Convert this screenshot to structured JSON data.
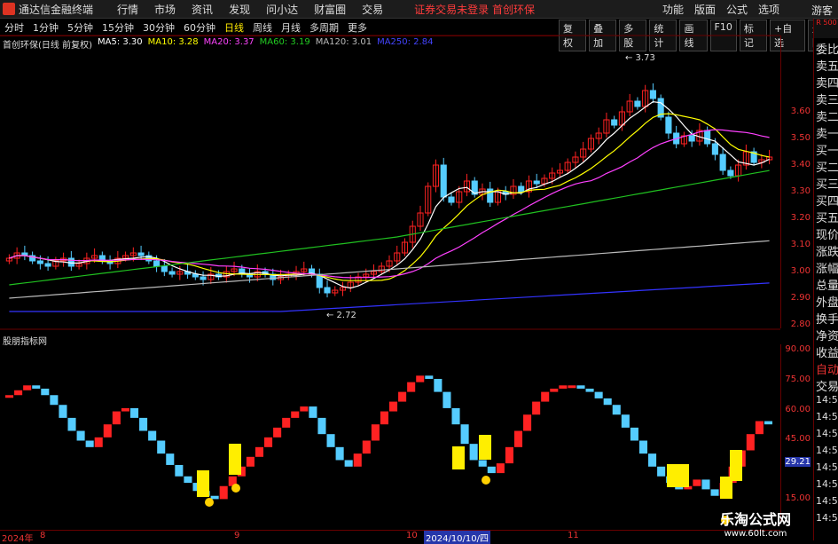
{
  "app": {
    "name": "通达信金融终端",
    "notice": "证券交易未登录 首创环保",
    "menu": [
      "行情",
      "市场",
      "资讯",
      "发现",
      "问小达",
      "财富圈",
      "交易"
    ],
    "right_menu": [
      "功能",
      "版面",
      "公式",
      "选项"
    ],
    "guest": "游客"
  },
  "tabs": [
    "分时",
    "1分钟",
    "5分钟",
    "15分钟",
    "30分钟",
    "60分钟",
    "日线",
    "周线",
    "月线",
    "多周期",
    "更多"
  ],
  "active_tab": "日线",
  "tools": [
    "复权",
    "叠加",
    "多股",
    "统计",
    "画线",
    "F10",
    "标记",
    "+自选",
    "返回"
  ],
  "legend": {
    "title": "首创环保(日线 前复权)",
    "ma5": "MA5: 3.30",
    "ma10": "MA10: 3.28",
    "ma20": "MA20: 3.37",
    "ma60": "MA60: 3.19",
    "ma120": "MA120: 3.01",
    "ma250": "MA250: 2.84"
  },
  "colors": {
    "ma5": "#ffffff",
    "ma10": "#ffff00",
    "ma20": "#ff40ff",
    "ma60": "#20c020",
    "ma120": "#bbbbbb",
    "ma250": "#3333ff",
    "up": "#ff2222",
    "down": "#55ccff",
    "axis": "#ee3333"
  },
  "price_axis": [
    "3.60",
    "3.50",
    "3.40",
    "3.30",
    "3.20",
    "3.10",
    "3.00",
    "2.90",
    "2.80"
  ],
  "annotations": {
    "high": "3.73",
    "low": "2.72"
  },
  "indicator": {
    "title": "股朋指标网",
    "axis": [
      "90.00",
      "75.00",
      "60.00",
      "45.00",
      "30.00",
      "15.00"
    ],
    "value": "29.21"
  },
  "right_side": {
    "badge": "R 500",
    "items": [
      "委比",
      "卖五",
      "卖四",
      "卖三",
      "卖二",
      "卖一",
      "买一",
      "买二",
      "买三",
      "买四",
      "买五",
      "现价",
      "涨跌",
      "涨幅",
      "总量",
      "外盘",
      "换手",
      "净资",
      "收益",
      "自动",
      "交易",
      "14:56",
      "14:56",
      "14:56",
      "14:56",
      "14:56",
      "14:56",
      "14:56",
      "14:56"
    ]
  },
  "dates": {
    "d1": "2024年",
    "d2": "8",
    "d3": "9",
    "d4": "10",
    "d5": "2024/10/10/四",
    "d6": "11"
  },
  "watermark": {
    "a": "乐淘公式网",
    "b": "www.60lt.com"
  }
}
